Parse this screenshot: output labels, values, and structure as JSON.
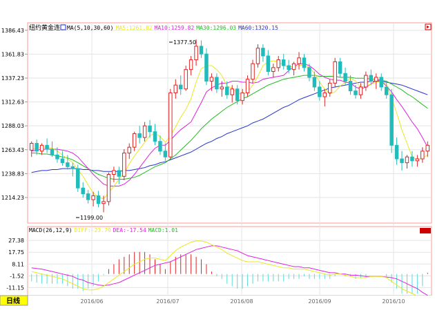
{
  "price_panel": {
    "instrument": "纽约黄金连续",
    "ma_legend": [
      {
        "label": "MA(5,10,30,60)",
        "color": "#000000"
      },
      {
        "label": "MA5:1261.82",
        "color": "#e8e820"
      },
      {
        "label": "MA10:1259.82",
        "color": "#dd22dd"
      },
      {
        "label": "MA30:1296.03",
        "color": "#22bb22"
      },
      {
        "label": "MA60:1320.15",
        "color": "#2233cc"
      }
    ],
    "y_ticks": [
      "1386.43",
      "1361.83",
      "1337.23",
      "1312.63",
      "1288.03",
      "1263.43",
      "1238.83",
      "1214.23"
    ],
    "high_label": "1377.50",
    "low_label": "1199.00"
  },
  "macd_panel": {
    "legend": [
      {
        "label": "MACD(26,12,9)",
        "color": "#000000"
      },
      {
        "label": "DIFF:-23.79",
        "color": "#e8e820"
      },
      {
        "label": "DEA:-17.54",
        "color": "#dd22dd"
      },
      {
        "label": "MACD:1.01",
        "color": "#22bb22"
      }
    ],
    "y_ticks": [
      "27.38",
      "17.75",
      "8.11",
      "-1.52",
      "-11.15"
    ]
  },
  "x_axis": {
    "period_button": "日线",
    "months": [
      "2016/06",
      "2016/07",
      "2016/08",
      "2016/09",
      "2016/10"
    ]
  },
  "colors": {
    "up": "#e02020",
    "down": "#22bbbb",
    "grid": "#e3e3e3",
    "axis": "#ff9999"
  },
  "chart_data": {
    "type": "candlestick",
    "ylim": [
      1190,
      1392
    ],
    "candles": [
      [
        1263,
        1272,
        1256,
        1270
      ],
      [
        1270,
        1274,
        1258,
        1262
      ],
      [
        1262,
        1270,
        1258,
        1268
      ],
      [
        1268,
        1275,
        1260,
        1264
      ],
      [
        1264,
        1272,
        1256,
        1258
      ],
      [
        1258,
        1266,
        1250,
        1254
      ],
      [
        1254,
        1262,
        1247,
        1250
      ],
      [
        1250,
        1258,
        1243,
        1246
      ],
      [
        1246,
        1250,
        1236,
        1244
      ],
      [
        1244,
        1248,
        1220,
        1224
      ],
      [
        1224,
        1230,
        1214,
        1218
      ],
      [
        1218,
        1222,
        1208,
        1212
      ],
      [
        1212,
        1220,
        1205,
        1216
      ],
      [
        1216,
        1221,
        1204,
        1208
      ],
      [
        1208,
        1216,
        1199,
        1210
      ],
      [
        1210,
        1240,
        1206,
        1238
      ],
      [
        1238,
        1246,
        1230,
        1242
      ],
      [
        1242,
        1246,
        1228,
        1236
      ],
      [
        1236,
        1264,
        1232,
        1260
      ],
      [
        1260,
        1270,
        1254,
        1266
      ],
      [
        1266,
        1282,
        1262,
        1280
      ],
      [
        1280,
        1288,
        1270,
        1276
      ],
      [
        1276,
        1292,
        1272,
        1288
      ],
      [
        1288,
        1294,
        1276,
        1282
      ],
      [
        1282,
        1290,
        1268,
        1272
      ],
      [
        1272,
        1278,
        1258,
        1262
      ],
      [
        1262,
        1270,
        1252,
        1256
      ],
      [
        1256,
        1326,
        1254,
        1322
      ],
      [
        1322,
        1336,
        1316,
        1330
      ],
      [
        1330,
        1340,
        1320,
        1326
      ],
      [
        1326,
        1350,
        1324,
        1346
      ],
      [
        1346,
        1360,
        1340,
        1356
      ],
      [
        1356,
        1377,
        1350,
        1370
      ],
      [
        1370,
        1376,
        1358,
        1362
      ],
      [
        1362,
        1368,
        1330,
        1334
      ],
      [
        1334,
        1342,
        1324,
        1338
      ],
      [
        1338,
        1342,
        1322,
        1326
      ],
      [
        1326,
        1334,
        1318,
        1328
      ],
      [
        1328,
        1334,
        1316,
        1320
      ],
      [
        1320,
        1330,
        1312,
        1326
      ],
      [
        1326,
        1330,
        1310,
        1314
      ],
      [
        1314,
        1326,
        1310,
        1322
      ],
      [
        1322,
        1340,
        1318,
        1336
      ],
      [
        1336,
        1356,
        1332,
        1352
      ],
      [
        1352,
        1372,
        1348,
        1368
      ],
      [
        1368,
        1372,
        1354,
        1360
      ],
      [
        1360,
        1366,
        1340,
        1344
      ],
      [
        1344,
        1352,
        1338,
        1348
      ],
      [
        1348,
        1360,
        1344,
        1356
      ],
      [
        1356,
        1362,
        1346,
        1350
      ],
      [
        1350,
        1356,
        1342,
        1346
      ],
      [
        1346,
        1354,
        1340,
        1352
      ],
      [
        1352,
        1364,
        1346,
        1358
      ],
      [
        1358,
        1362,
        1344,
        1348
      ],
      [
        1348,
        1352,
        1334,
        1338
      ],
      [
        1338,
        1344,
        1324,
        1328
      ],
      [
        1328,
        1334,
        1314,
        1318
      ],
      [
        1318,
        1326,
        1308,
        1322
      ],
      [
        1322,
        1336,
        1318,
        1332
      ],
      [
        1332,
        1358,
        1328,
        1354
      ],
      [
        1354,
        1358,
        1338,
        1342
      ],
      [
        1342,
        1348,
        1330,
        1334
      ],
      [
        1334,
        1340,
        1320,
        1324
      ],
      [
        1324,
        1330,
        1316,
        1320
      ],
      [
        1320,
        1332,
        1316,
        1328
      ],
      [
        1328,
        1344,
        1324,
        1340
      ],
      [
        1340,
        1346,
        1330,
        1334
      ],
      [
        1334,
        1342,
        1326,
        1338
      ],
      [
        1338,
        1342,
        1324,
        1328
      ],
      [
        1328,
        1334,
        1316,
        1320
      ],
      [
        1320,
        1326,
        1260,
        1268
      ],
      [
        1268,
        1276,
        1248,
        1254
      ],
      [
        1254,
        1262,
        1242,
        1250
      ],
      [
        1250,
        1258,
        1244,
        1256
      ],
      [
        1256,
        1262,
        1246,
        1252
      ],
      [
        1252,
        1258,
        1246,
        1254
      ],
      [
        1254,
        1266,
        1250,
        1262
      ],
      [
        1262,
        1272,
        1256,
        1268
      ]
    ],
    "ma5": [
      1264,
      1265,
      1266,
      1266,
      1265,
      1262,
      1258,
      1254,
      1250,
      1243,
      1236,
      1227,
      1219,
      1214,
      1213,
      1219,
      1226,
      1233,
      1239,
      1249,
      1257,
      1264,
      1271,
      1278,
      1280,
      1277,
      1271,
      1278,
      1287,
      1297,
      1305,
      1316,
      1333,
      1347,
      1350,
      1350,
      1346,
      1340,
      1329,
      1327,
      1322,
      1320,
      1323,
      1330,
      1339,
      1350,
      1354,
      1355,
      1354,
      1350,
      1349,
      1349,
      1350,
      1351,
      1348,
      1342,
      1333,
      1326,
      1321,
      1323,
      1329,
      1333,
      1337,
      1334,
      1328,
      1329,
      1331,
      1333,
      1334,
      1331,
      1317,
      1301,
      1284,
      1270,
      1256,
      1253,
      1255,
      1258
    ],
    "ma10": [
      1262,
      1263,
      1264,
      1264,
      1264,
      1264,
      1263,
      1262,
      1260,
      1256,
      1250,
      1244,
      1238,
      1233,
      1228,
      1226,
      1226,
      1226,
      1228,
      1232,
      1238,
      1245,
      1252,
      1259,
      1265,
      1268,
      1268,
      1273,
      1279,
      1284,
      1288,
      1292,
      1302,
      1312,
      1323,
      1327,
      1330,
      1332,
      1332,
      1334,
      1334,
      1333,
      1333,
      1332,
      1333,
      1336,
      1337,
      1338,
      1339,
      1340,
      1345,
      1349,
      1352,
      1352,
      1350,
      1346,
      1341,
      1338,
      1336,
      1335,
      1335,
      1333,
      1332,
      1328,
      1326,
      1328,
      1331,
      1335,
      1334,
      1329,
      1323,
      1315,
      1308,
      1300,
      1292,
      1285,
      1276,
      1266
    ],
    "ma30": [
      1260,
      1260,
      1259,
      1259,
      1258,
      1257,
      1256,
      1255,
      1253,
      1250,
      1247,
      1244,
      1241,
      1238,
      1236,
      1234,
      1233,
      1233,
      1233,
      1234,
      1235,
      1237,
      1240,
      1243,
      1246,
      1248,
      1250,
      1254,
      1258,
      1263,
      1268,
      1273,
      1279,
      1285,
      1290,
      1295,
      1299,
      1303,
      1307,
      1310,
      1313,
      1316,
      1318,
      1321,
      1324,
      1327,
      1330,
      1332,
      1334,
      1336,
      1337,
      1338,
      1339,
      1340,
      1340,
      1340,
      1339,
      1339,
      1339,
      1339,
      1338,
      1338,
      1338,
      1337,
      1337,
      1337,
      1336,
      1336,
      1335,
      1334,
      1331,
      1328,
      1325,
      1321,
      1318,
      1314,
      1310,
      1306
    ],
    "ma60": [
      1240,
      1241,
      1242,
      1242,
      1243,
      1243,
      1244,
      1244,
      1244,
      1244,
      1243,
      1243,
      1242,
      1242,
      1241,
      1241,
      1241,
      1241,
      1242,
      1242,
      1243,
      1244,
      1245,
      1247,
      1248,
      1250,
      1251,
      1253,
      1255,
      1257,
      1259,
      1261,
      1264,
      1267,
      1270,
      1272,
      1275,
      1277,
      1280,
      1282,
      1284,
      1286,
      1288,
      1291,
      1293,
      1295,
      1298,
      1301,
      1304,
      1307,
      1309,
      1312,
      1315,
      1317,
      1319,
      1321,
      1323,
      1325,
      1327,
      1328,
      1329,
      1330,
      1331,
      1332,
      1333,
      1333,
      1334,
      1334,
      1334,
      1333,
      1332,
      1331,
      1330,
      1328,
      1326,
      1324,
      1322,
      1320
    ],
    "macd_ylim": [
      -16,
      32
    ],
    "diff": [
      2,
      1,
      0,
      -1,
      -2,
      -3,
      -4,
      -6,
      -8,
      -10,
      -12,
      -13,
      -13,
      -12,
      -10,
      -7,
      -4,
      -1,
      2,
      5,
      8,
      10,
      12,
      13,
      13,
      12,
      11,
      15,
      19,
      22,
      24,
      26,
      27,
      27,
      26,
      24,
      22,
      20,
      17,
      15,
      13,
      11,
      10,
      10,
      10,
      9,
      8,
      7,
      6,
      5,
      5,
      4,
      4,
      4,
      3,
      2,
      1,
      0,
      -1,
      0,
      0,
      -1,
      -2,
      -3,
      -3,
      -3,
      -2,
      -2,
      -2,
      -3,
      -6,
      -9,
      -12,
      -14,
      -16,
      -18,
      -20,
      -23.79
    ],
    "dea": [
      5,
      4.5,
      4,
      3,
      2,
      1,
      0,
      -1,
      -2,
      -4,
      -5,
      -7,
      -8,
      -9,
      -9.5,
      -9,
      -8,
      -7,
      -5,
      -3,
      -1,
      1,
      3,
      5,
      7,
      8,
      9,
      10,
      12,
      14,
      16,
      18,
      20,
      21,
      22,
      23,
      23,
      22,
      21,
      20,
      19,
      17,
      15,
      14,
      13,
      12,
      11,
      10,
      9,
      8,
      7,
      6,
      6,
      5,
      5,
      4,
      3,
      2,
      1,
      1,
      0,
      0,
      -1,
      -1,
      -1.5,
      -2,
      -2,
      -2,
      -2,
      -2.5,
      -3,
      -4,
      -6,
      -8,
      -10,
      -12,
      -15,
      -17.54
    ],
    "macd": [
      -6,
      -7,
      -8,
      -8,
      -8,
      -8,
      -8,
      -10,
      -12,
      -12,
      -14,
      -12,
      -10,
      -6,
      -1,
      4,
      8,
      12,
      14,
      16,
      18,
      18,
      18,
      16,
      12,
      8,
      4,
      10,
      14,
      16,
      16,
      16,
      14,
      12,
      8,
      2,
      -2,
      -4,
      -8,
      -10,
      -12,
      -12,
      -10,
      -8,
      -6,
      -6,
      -6,
      -6,
      -6,
      -6,
      -4,
      -4,
      -4,
      -2,
      -4,
      -4,
      -4,
      -4,
      -4,
      -2,
      0,
      -2,
      -2,
      -4,
      -3,
      -3,
      0,
      0,
      0,
      -2,
      -7,
      -12,
      -16,
      -16,
      -16,
      -16,
      -10,
      1.01
    ]
  }
}
